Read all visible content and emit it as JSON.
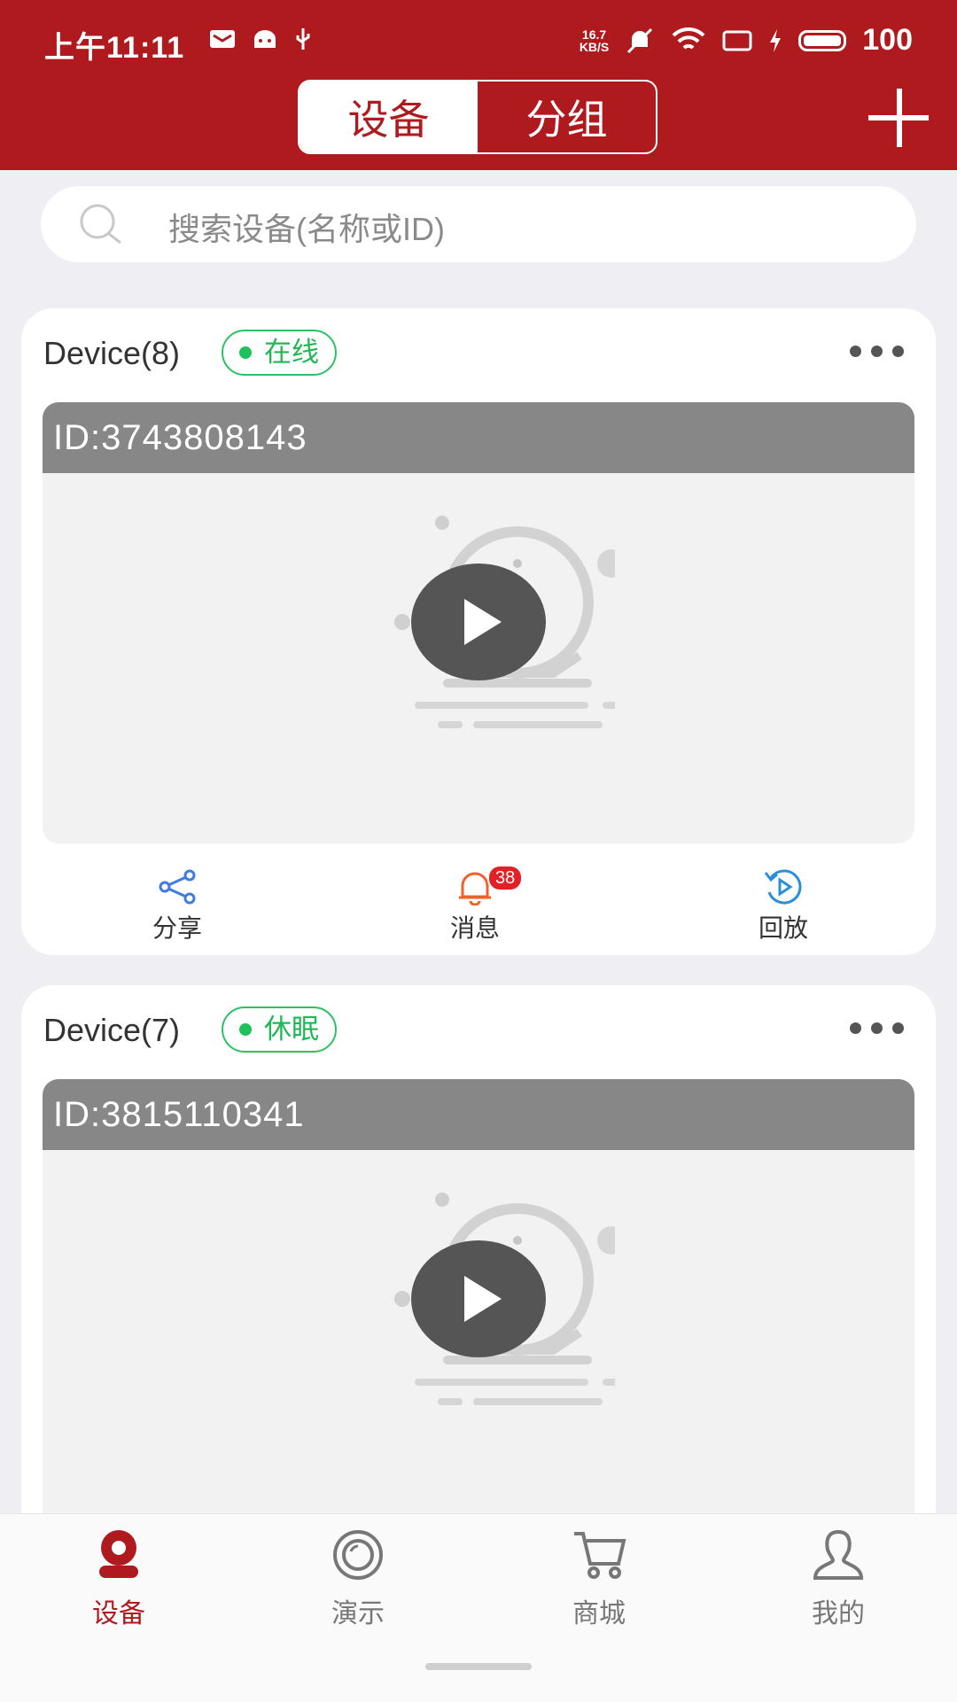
{
  "status_bar": {
    "time": "上午11:11",
    "net_speed_value": "16.7",
    "net_speed_unit": "KB/S",
    "battery": "100"
  },
  "header": {
    "segments": [
      "设备",
      "分组"
    ],
    "active_segment": "设备",
    "add_icon": "plus-icon"
  },
  "search": {
    "placeholder": "搜索设备(名称或ID)"
  },
  "devices": [
    {
      "name": "Device(8)",
      "status": "在线",
      "id_label": "ID:3743808143",
      "actions": [
        {
          "label": "分享",
          "icon": "share-icon"
        },
        {
          "label": "消息",
          "icon": "bell-icon",
          "badge": "38"
        },
        {
          "label": "回放",
          "icon": "playback-icon"
        }
      ]
    },
    {
      "name": "Device(7)",
      "status": "休眠",
      "id_label": "ID:3815110341"
    }
  ],
  "bottom_nav": [
    {
      "label": "设备",
      "icon": "camera-icon",
      "active": true
    },
    {
      "label": "演示",
      "icon": "demo-icon",
      "active": false
    },
    {
      "label": "商城",
      "icon": "cart-icon",
      "active": false
    },
    {
      "label": "我的",
      "icon": "user-icon",
      "active": false
    }
  ],
  "colors": {
    "brand": "#ae1a1d",
    "online": "#1fb854",
    "badge": "#e32026"
  }
}
